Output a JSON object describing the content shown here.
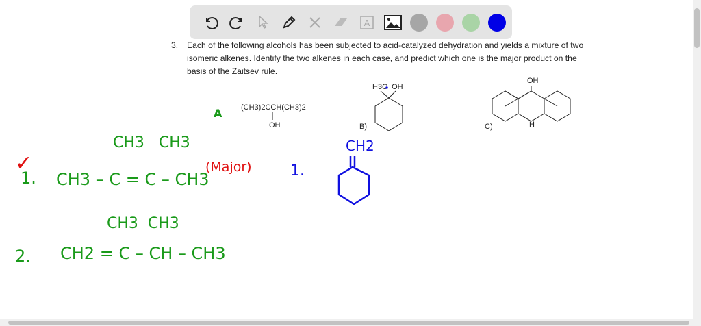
{
  "toolbar": {
    "tools": [
      "undo-icon",
      "redo-icon",
      "pointer-icon",
      "pen-icon",
      "tools-icon",
      "eraser-icon",
      "text-icon",
      "image-icon"
    ],
    "colors": [
      "#a6a6a6",
      "#e8a6ae",
      "#a9d4a6",
      "#0000e6"
    ]
  },
  "question": {
    "number": "3.",
    "text": "Each of the following alcohols has been subjected to acid-catalyzed dehydration and yields a mixture of two isomeric alkenes. Identify the two alkenes in each case, and predict which one is the major product on the basis of the Zaitsev rule."
  },
  "structures": {
    "a": {
      "formula": "(CH3)2CCH(CH3)2",
      "oh": "OH"
    },
    "b": {
      "label": "B)",
      "substituents": "H3C  OH"
    },
    "c": {
      "label": "C)",
      "top": "OH",
      "bottom": "H"
    }
  },
  "notes": {
    "a_label": "A",
    "check": "✓",
    "p1_num": "1.",
    "p1_top": "CH3   CH3",
    "p1_main": "CH3 – C = C – CH3",
    "major": "(Major)",
    "p2_num": "2.",
    "p2_top": "CH3  CH3",
    "p2_main": "CH2 = C – CH – CH3",
    "b1_num": "1.",
    "b1_ch2": "CH2"
  },
  "colors": {
    "green": "#1a9a1a",
    "red": "#e01010",
    "blue": "#1010e0"
  }
}
